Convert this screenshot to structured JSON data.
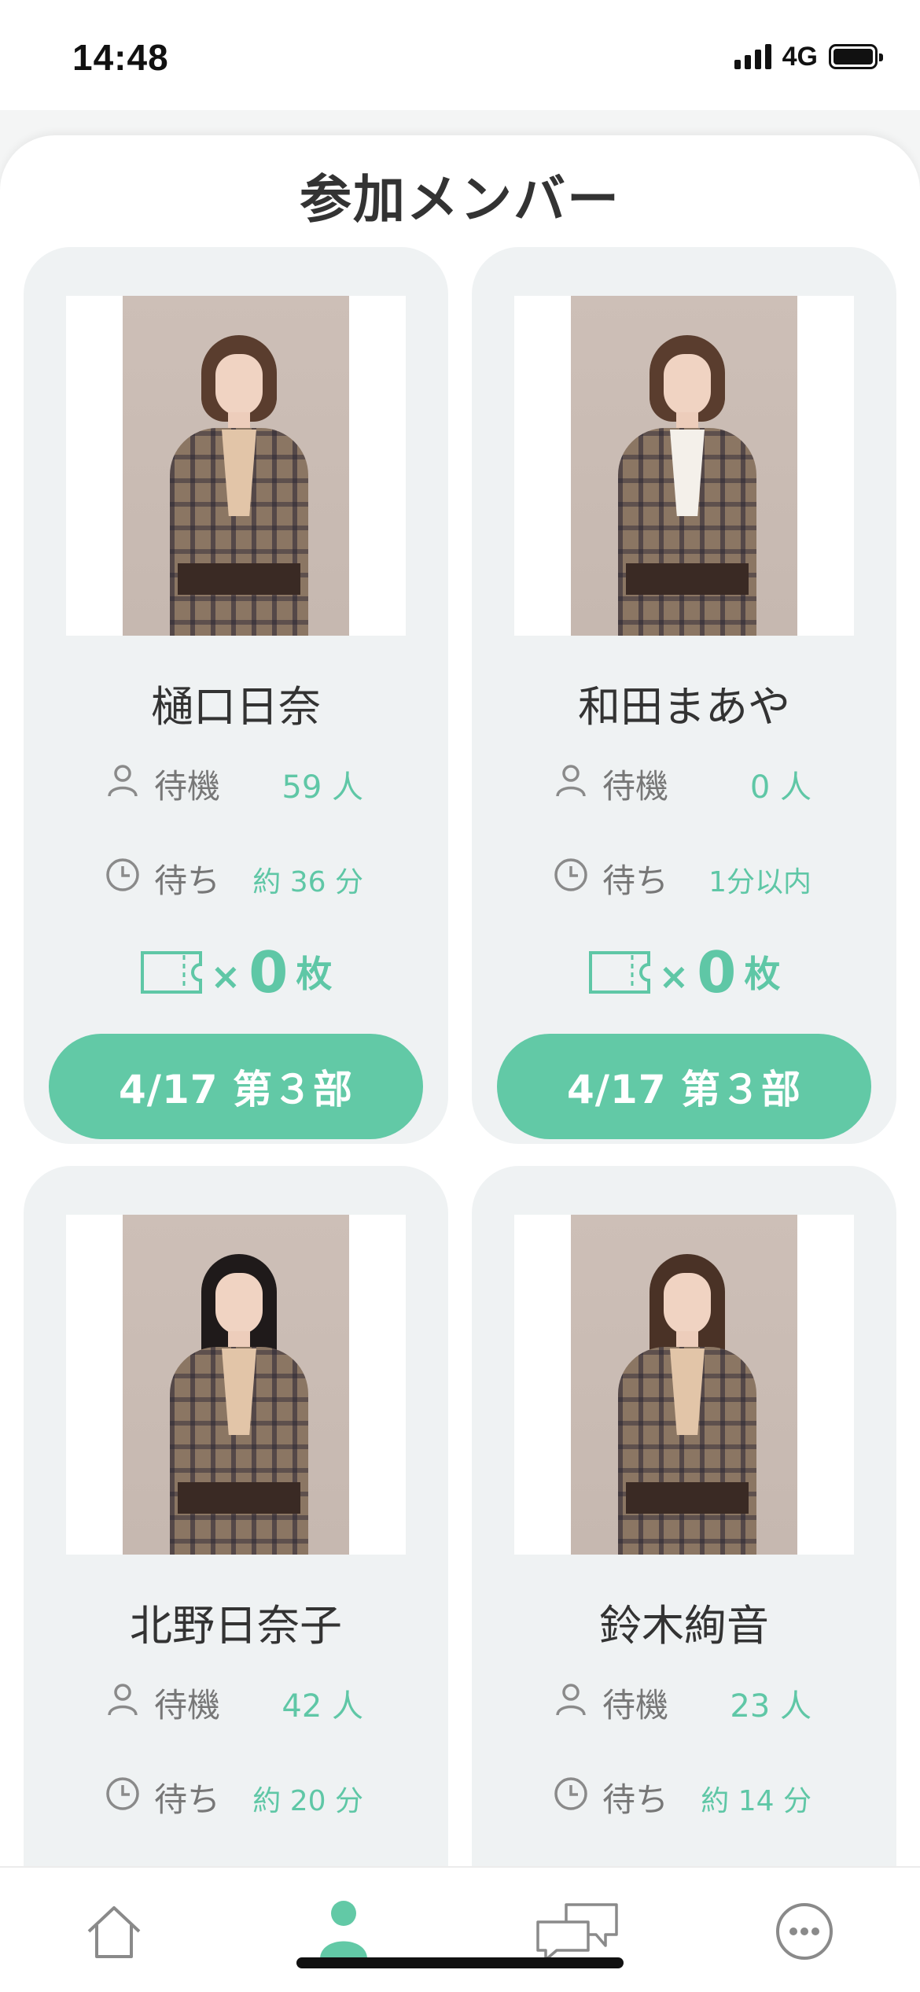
{
  "status_bar": {
    "time": "14:48",
    "network": "4G"
  },
  "page": {
    "title": "参加メンバー"
  },
  "members": [
    {
      "name": "樋口日奈",
      "waiting_label": "待機",
      "waiting_value": "59 人",
      "wait_time_label": "待ち",
      "wait_time_value": "約 36 分",
      "ticket_x": "×",
      "ticket_count": "0",
      "ticket_unit": "枚",
      "session_button": "4/17 第３部"
    },
    {
      "name": "和田まあや",
      "waiting_label": "待機",
      "waiting_value": "0 人",
      "wait_time_label": "待ち",
      "wait_time_value": "1分以内",
      "ticket_x": "×",
      "ticket_count": "0",
      "ticket_unit": "枚",
      "session_button": "4/17 第３部"
    },
    {
      "name": "北野日奈子",
      "waiting_label": "待機",
      "waiting_value": "42 人",
      "wait_time_label": "待ち",
      "wait_time_value": "約 20 分"
    },
    {
      "name": "鈴木絢音",
      "waiting_label": "待機",
      "waiting_value": "23 人",
      "wait_time_label": "待ち",
      "wait_time_value": "約 14 分"
    }
  ],
  "colors": {
    "accent": "#62c9a6",
    "accent_text": "#5fc7a6",
    "card_bg": "#eff2f3"
  },
  "tab_bar": {
    "tabs": [
      {
        "icon": "home-icon",
        "active": false
      },
      {
        "icon": "person-icon",
        "active": true
      },
      {
        "icon": "chat-icon",
        "active": false
      },
      {
        "icon": "more-icon",
        "active": false
      }
    ]
  }
}
